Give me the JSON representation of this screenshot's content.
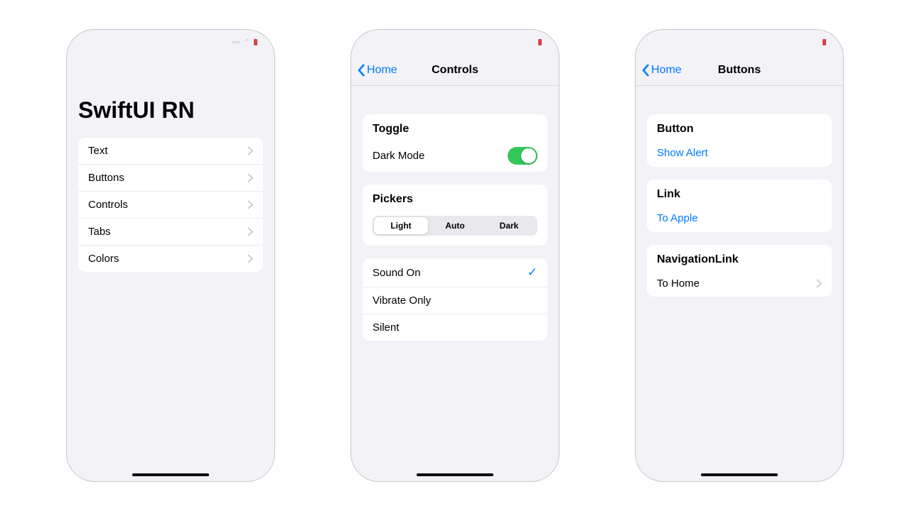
{
  "phone1": {
    "title": "SwiftUI RN",
    "menu": [
      "Text",
      "Buttons",
      "Controls",
      "Tabs",
      "Colors"
    ]
  },
  "phone2": {
    "back": "Home",
    "title": "Controls",
    "toggle": {
      "header": "Toggle",
      "label": "Dark Mode"
    },
    "pickers": {
      "header": "Pickers",
      "segments": [
        "Light",
        "Auto",
        "Dark"
      ]
    },
    "soundList": [
      "Sound On",
      "Vibrate Only",
      "Silent"
    ]
  },
  "phone3": {
    "back": "Home",
    "title": "Buttons",
    "button": {
      "header": "Button",
      "action": "Show Alert"
    },
    "link": {
      "header": "Link",
      "action": "To Apple"
    },
    "navlink": {
      "header": "NavigationLink",
      "action": "To Home"
    }
  }
}
